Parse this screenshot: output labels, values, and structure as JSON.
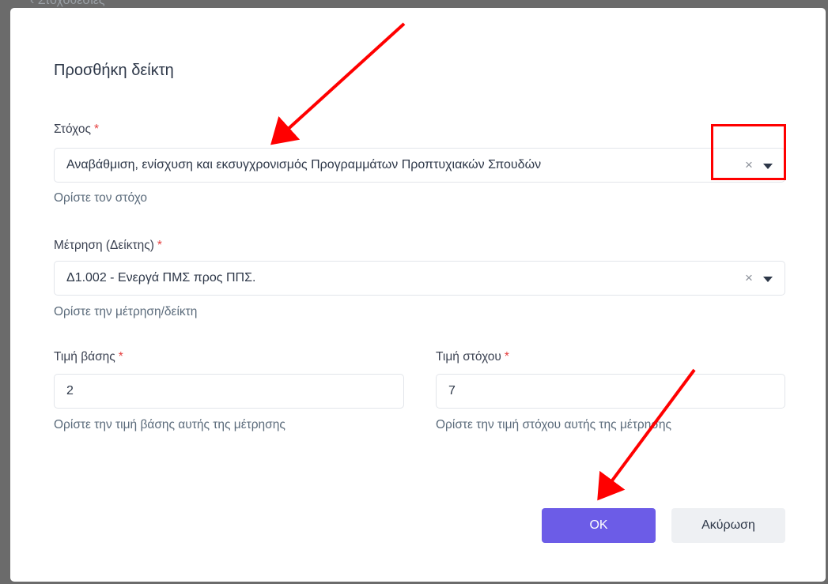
{
  "backdrop": {
    "text": "Στοχοθεσίες"
  },
  "dialog": {
    "title": "Προσθήκη δείκτη",
    "goal": {
      "label": "Στόχος",
      "required_mark": "*",
      "value": "Αναβάθμιση, ενίσχυση και εκσυγχρονισμός Προγραμμάτων Προπτυχιακών Σπουδών",
      "help": "Ορίστε τον στόχο"
    },
    "measure": {
      "label": "Μέτρηση (Δείκτης)",
      "required_mark": "*",
      "value": "Δ1.002 - Ενεργά ΠΜΣ προς ΠΠΣ.",
      "help": "Ορίστε την μέτρηση/δείκτη"
    },
    "base_value": {
      "label": "Τιμή βάσης",
      "required_mark": "*",
      "value": "2",
      "help": "Ορίστε την τιμή βάσης αυτής της μέτρησης"
    },
    "target_value": {
      "label": "Τιμή στόχου",
      "required_mark": "*",
      "value": "7",
      "help": "Ορίστε την τιμή στόχου αυτής της μέτρησης"
    },
    "buttons": {
      "ok": "OK",
      "cancel": "Ακύρωση"
    },
    "icons": {
      "clear": "×",
      "dropdown": "caret-down"
    }
  },
  "colors": {
    "primary": "#6c5ce7",
    "required": "#e53e3e",
    "annotation": "#ff0000"
  }
}
